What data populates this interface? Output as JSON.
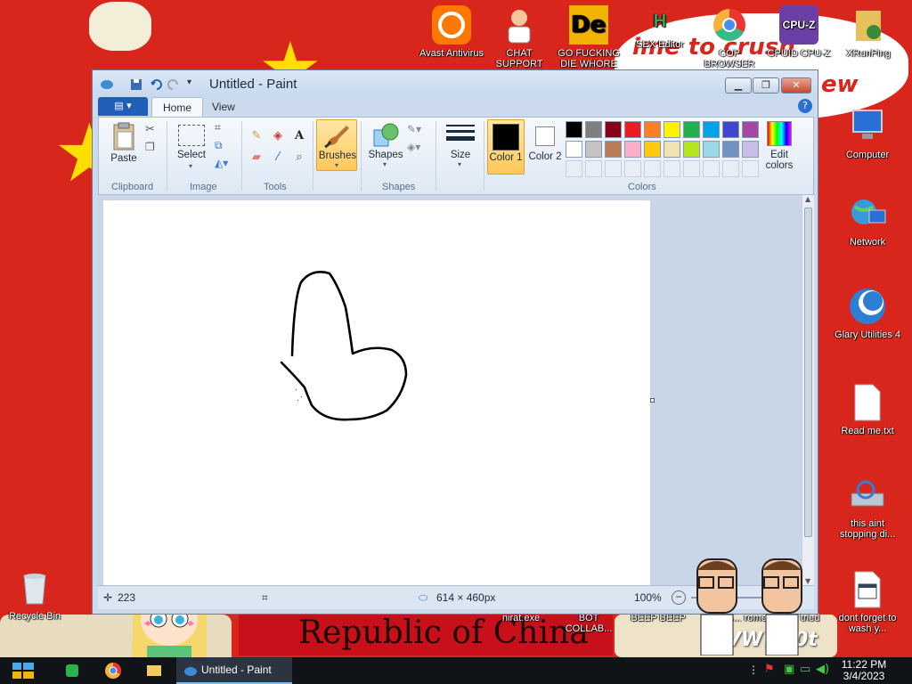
{
  "wallpaper": {
    "banner_text": "Republic of China",
    "overlay_text_1": "ime to crush",
    "overlay_text_2": "ew",
    "watermark": "VWw60t"
  },
  "desktop_icons": [
    {
      "id": "avast",
      "label": "Avast Antivirus",
      "icon": "avast-icon"
    },
    {
      "id": "chat-support",
      "label": "CHAT SUPPORT",
      "icon": "doctor-icon"
    },
    {
      "id": "go-fucking",
      "label": "GO FUCKING DIE WHORE",
      "icon": "de-icon"
    },
    {
      "id": "sex-editor",
      "label": "SEX Editor",
      "icon": "h-icon"
    },
    {
      "id": "cop-browser",
      "label": "COP BROWSER",
      "icon": "chrome-icon"
    },
    {
      "id": "cpuid",
      "label": "CPUID CPU-Z",
      "icon": "cpuz-icon"
    },
    {
      "id": "xrunping",
      "label": "XRunPing",
      "icon": "ping-icon"
    },
    {
      "id": "computer",
      "label": "Computer",
      "icon": "computer-icon"
    },
    {
      "id": "network",
      "label": "Network",
      "icon": "network-icon"
    },
    {
      "id": "glary",
      "label": "Glary Utilities 4",
      "icon": "glary-icon"
    },
    {
      "id": "readme",
      "label": "Read me.txt",
      "icon": "text-file-icon"
    },
    {
      "id": "this-aint",
      "label": "this aint stopping di...",
      "icon": "scanner-icon"
    },
    {
      "id": "dont-forget",
      "label": "dont forget to wash y...",
      "icon": "calendar-file-icon"
    },
    {
      "id": "recycle",
      "label": "Recycle Bin",
      "icon": "recycle-bin-icon"
    },
    {
      "id": "nirat",
      "label": "nirat.exe",
      "icon": "exe-icon"
    },
    {
      "id": "bot-collab",
      "label": "BOT COLLAB...",
      "icon": "folder-icon"
    },
    {
      "id": "beep-beep",
      "label": "BEEP BEEP",
      "icon": "exe-icon"
    },
    {
      "id": "comm",
      "label": "comm... rome",
      "icon": "exe-icon"
    },
    {
      "id": "u-tried",
      "label": "u tried",
      "icon": "exe-icon"
    }
  ],
  "paint": {
    "title": "Untitled - Paint",
    "tabs": {
      "file": "",
      "home": "Home",
      "view": "View"
    },
    "ribbon": {
      "paste": "Paste",
      "select": "Select",
      "brushes": "Brushes",
      "shapes": "Shapes",
      "size": "Size",
      "color1": "Color 1",
      "color2": "Color 2",
      "edit_colors": "Edit colors",
      "groups": {
        "clipboard": "Clipboard",
        "image": "Image",
        "tools": "Tools",
        "shapes": "Shapes",
        "colors": "Colors"
      }
    },
    "palette": [
      "#000000",
      "#7f7f7f",
      "#880015",
      "#ed1c24",
      "#ff7f27",
      "#fff200",
      "#22b14c",
      "#00a2e8",
      "#3f48cc",
      "#a349a4",
      "#ffffff",
      "#c3c3c3",
      "#b97a57",
      "#ffaec9",
      "#ffc90e",
      "#efe4b0",
      "#b5e61d",
      "#99d9ea",
      "#7092be",
      "#c8bfe7"
    ],
    "color1": "#000000",
    "color2": "#ffffff",
    "status": {
      "cursor_pos": "223",
      "canvas_size": "614 × 460px",
      "zoom": "100%"
    }
  },
  "taskbar": {
    "window_label": "Untitled - Paint",
    "time": "11:22 PM",
    "date": "3/4/2023"
  }
}
